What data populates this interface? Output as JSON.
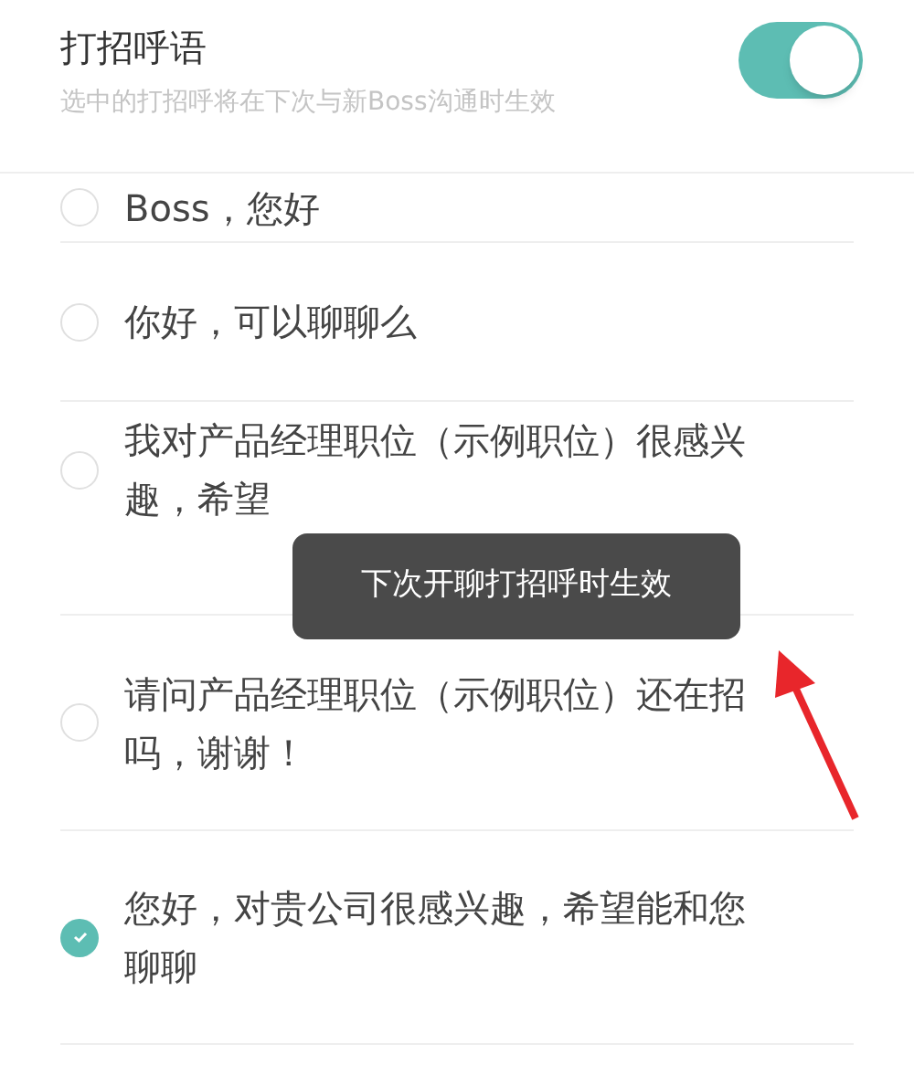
{
  "header": {
    "title": "打招呼语",
    "subtitle": "选中的打招呼将在下次与新Boss沟通时生效",
    "toggle": {
      "on": true
    }
  },
  "greetings": [
    {
      "text": "Boss，您好",
      "selected": false
    },
    {
      "text": "你好，可以聊聊么",
      "selected": false
    },
    {
      "text": "我对产品经理职位（示例职位）很感兴趣，希望",
      "selected": false
    },
    {
      "text": "请问产品经理职位（示例职位）还在招吗，谢谢！",
      "selected": false
    },
    {
      "text": "您好，对贵公司很感兴趣，希望能和您聊聊",
      "selected": true
    }
  ],
  "toast": {
    "text": "下次开聊打招呼时生效"
  }
}
